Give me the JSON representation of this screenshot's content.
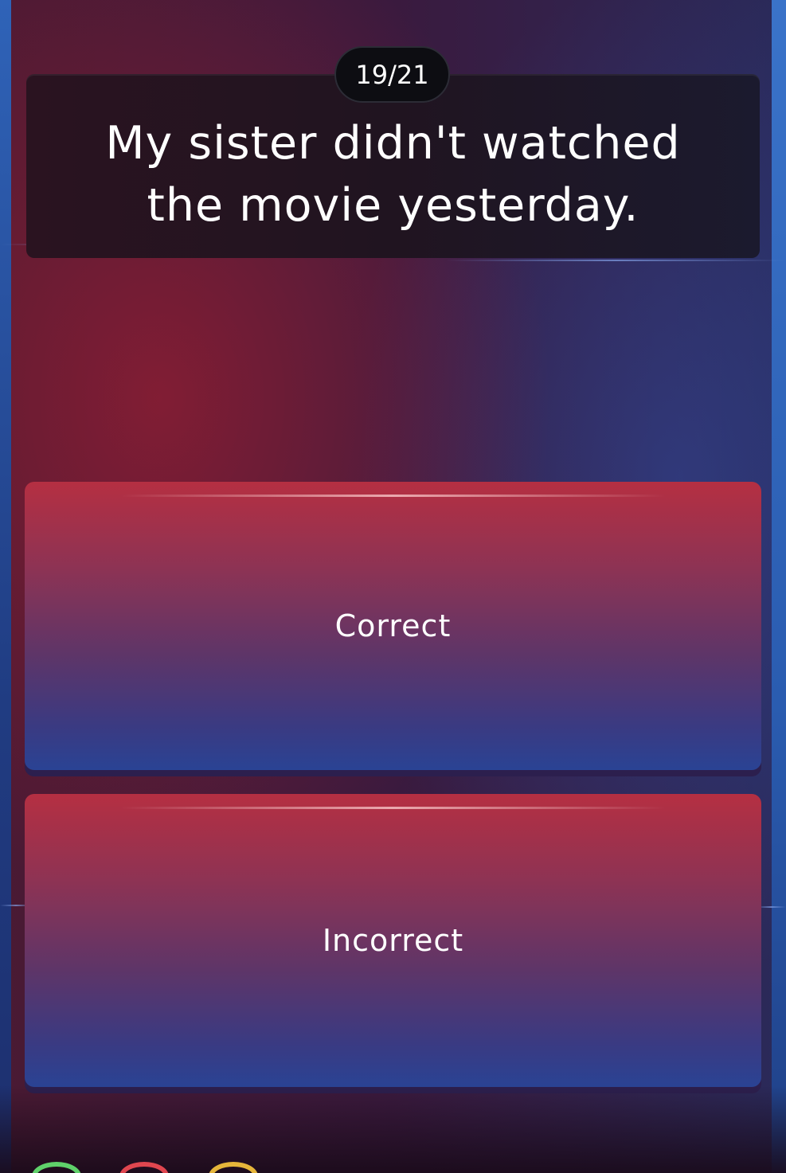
{
  "quiz": {
    "counter": "19/21",
    "question": "My sister didn't watched the movie yesterday.",
    "answers": [
      {
        "label": "Correct"
      },
      {
        "label": "Incorrect"
      }
    ]
  },
  "colors": {
    "answer_top": "#b52f42",
    "answer_bottom": "#2a4394",
    "indicator_green": "#5fd16a",
    "indicator_red": "#e0464f",
    "indicator_yellow": "#e6b53a"
  }
}
